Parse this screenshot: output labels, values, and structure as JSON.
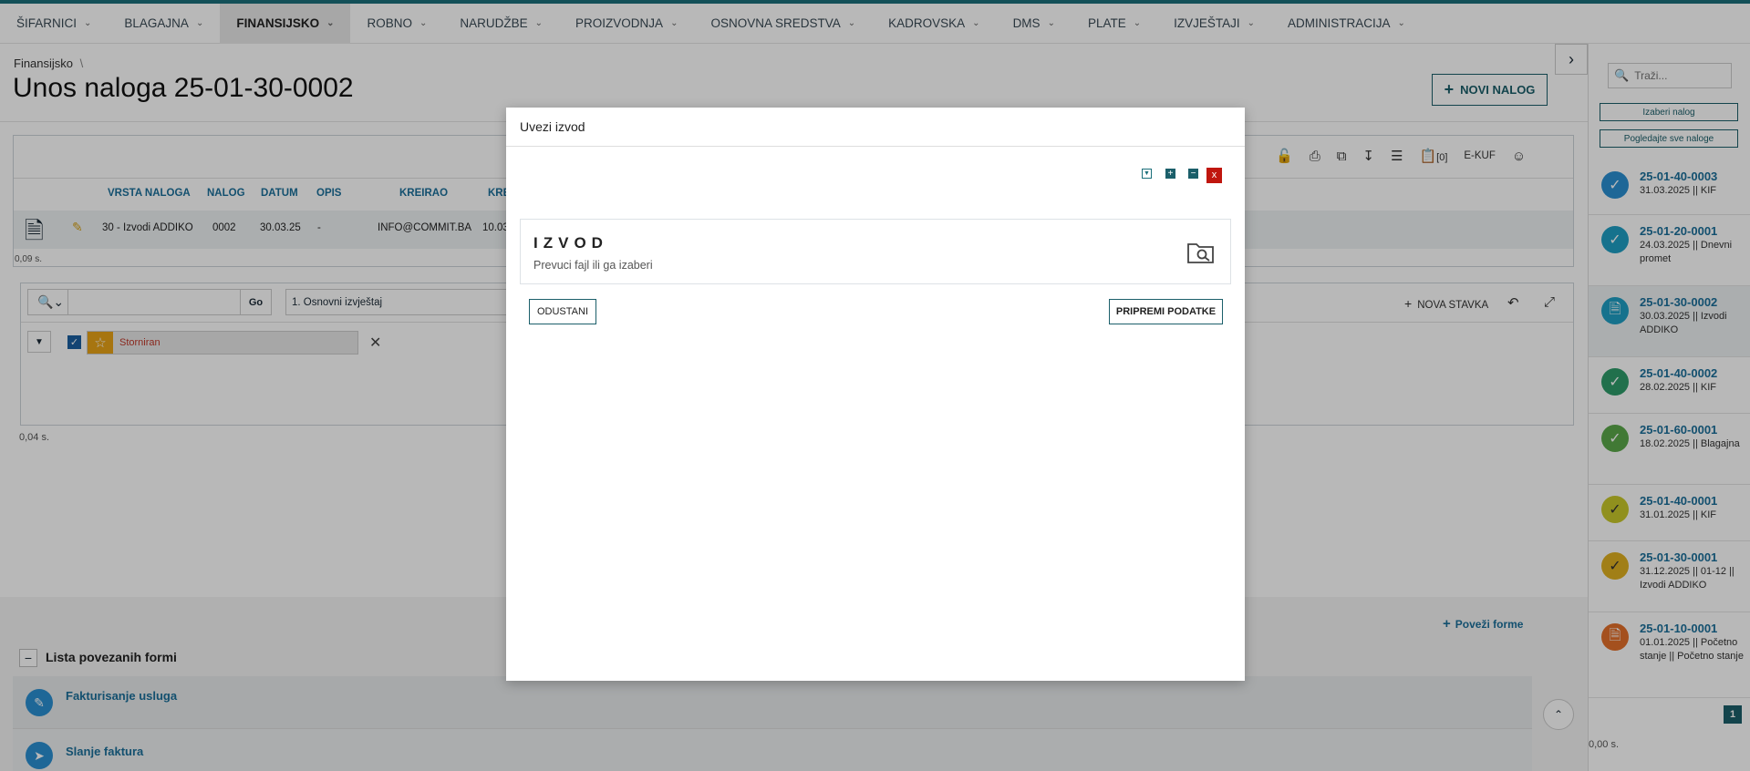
{
  "nav": {
    "items": [
      {
        "label": "ŠIFARNICI"
      },
      {
        "label": "BLAGAJNA"
      },
      {
        "label": "FINANSIJSKO"
      },
      {
        "label": "ROBNO"
      },
      {
        "label": "NARUDŽBE"
      },
      {
        "label": "PROIZVODNJA"
      },
      {
        "label": "OSNOVNA SREDSTVA"
      },
      {
        "label": "KADROVSKA"
      },
      {
        "label": "DMS"
      },
      {
        "label": "PLATE"
      },
      {
        "label": "IZVJEŠTAJI"
      },
      {
        "label": "ADMINISTRACIJA"
      }
    ]
  },
  "breadcrumb": "Finansijsko",
  "breadcrumb_sep": "\\",
  "page_title": "Unos naloga 25-01-30-0002",
  "novi_nalog": "NOVI NALOG",
  "toolbar": {
    "count": "[0]",
    "ekuf": "E-KUF"
  },
  "table": {
    "headers": [
      "VRSTA NALOGA",
      "NALOG",
      "DATUM",
      "OPIS",
      "KREIRAO",
      "KRE"
    ],
    "row": [
      "30 - Izvodi ADDIKO",
      "0002",
      "30.03.25",
      "-",
      "INFO@COMMIT.BA",
      "10.03."
    ],
    "time": "0,09 s."
  },
  "items": {
    "search_go": "Go",
    "report": "1. Osnovni izvještaj",
    "nova_stavka": "NOVA STAVKA",
    "filter_tag": "Storniran",
    "time": "0,04 s."
  },
  "linked": {
    "povezi": "Poveži forme",
    "title": "Lista povezanih formi",
    "rows": [
      {
        "label": "Fakturisanje usluga"
      },
      {
        "label": "Slanje faktura"
      }
    ]
  },
  "sidebar": {
    "search_placeholder": "Traži...",
    "izaberi": "Izaberi nalog",
    "pogledajte": "Pogledajte sve naloge",
    "entries": [
      {
        "name": "25-01-40-0003",
        "sub": "31.03.2025 || KIF",
        "color": "#2a8fd1"
      },
      {
        "name": "25-01-20-0001",
        "sub": "24.03.2025 || Dnevni promet",
        "color": "#1f9fc4"
      },
      {
        "name": "25-01-30-0002",
        "sub": "30.03.2025 || Izvodi ADDIKO",
        "color": "#1f9fc4"
      },
      {
        "name": "25-01-40-0002",
        "sub": "28.02.2025 || KIF",
        "color": "#2e9c6a"
      },
      {
        "name": "25-01-60-0001",
        "sub": "18.02.2025 || Blagajna",
        "color": "#5aa84a"
      },
      {
        "name": "25-01-40-0001",
        "sub": "31.01.2025 || KIF",
        "color": "#c8c82a"
      },
      {
        "name": "25-01-30-0001",
        "sub": "31.12.2025 || 01-12 || Izvodi ADDIKO",
        "color": "#e0b020"
      },
      {
        "name": "25-01-10-0001",
        "sub": "01.01.2025 || Početno stanje || Početno stanje",
        "color": "#e4702a"
      }
    ],
    "page": "1",
    "time": "0,00 s."
  },
  "modal": {
    "title": "Uvezi izvod",
    "close": "x",
    "drop_title": "IZVOD",
    "drop_sub": "Prevuci fajl ili ga izaberi",
    "cancel": "ODUSTANI",
    "prepare": "PRIPREMI PODATKE"
  }
}
